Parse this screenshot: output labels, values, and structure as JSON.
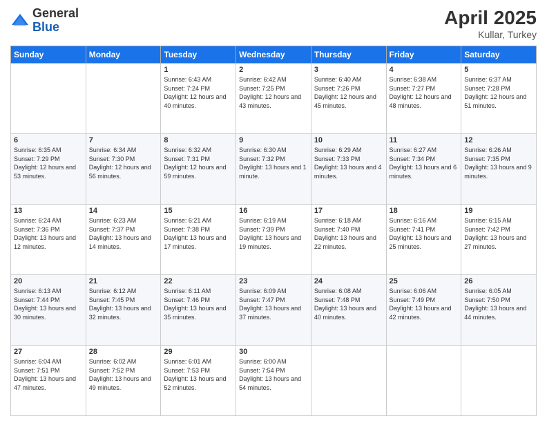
{
  "header": {
    "logo": {
      "general": "General",
      "blue": "Blue"
    },
    "title": "April 2025",
    "subtitle": "Kullar, Turkey"
  },
  "days_of_week": [
    "Sunday",
    "Monday",
    "Tuesday",
    "Wednesday",
    "Thursday",
    "Friday",
    "Saturday"
  ],
  "weeks": [
    [
      {
        "day": "",
        "sunrise": "",
        "sunset": "",
        "daylight": ""
      },
      {
        "day": "",
        "sunrise": "",
        "sunset": "",
        "daylight": ""
      },
      {
        "day": "1",
        "sunrise": "Sunrise: 6:43 AM",
        "sunset": "Sunset: 7:24 PM",
        "daylight": "Daylight: 12 hours and 40 minutes."
      },
      {
        "day": "2",
        "sunrise": "Sunrise: 6:42 AM",
        "sunset": "Sunset: 7:25 PM",
        "daylight": "Daylight: 12 hours and 43 minutes."
      },
      {
        "day": "3",
        "sunrise": "Sunrise: 6:40 AM",
        "sunset": "Sunset: 7:26 PM",
        "daylight": "Daylight: 12 hours and 45 minutes."
      },
      {
        "day": "4",
        "sunrise": "Sunrise: 6:38 AM",
        "sunset": "Sunset: 7:27 PM",
        "daylight": "Daylight: 12 hours and 48 minutes."
      },
      {
        "day": "5",
        "sunrise": "Sunrise: 6:37 AM",
        "sunset": "Sunset: 7:28 PM",
        "daylight": "Daylight: 12 hours and 51 minutes."
      }
    ],
    [
      {
        "day": "6",
        "sunrise": "Sunrise: 6:35 AM",
        "sunset": "Sunset: 7:29 PM",
        "daylight": "Daylight: 12 hours and 53 minutes."
      },
      {
        "day": "7",
        "sunrise": "Sunrise: 6:34 AM",
        "sunset": "Sunset: 7:30 PM",
        "daylight": "Daylight: 12 hours and 56 minutes."
      },
      {
        "day": "8",
        "sunrise": "Sunrise: 6:32 AM",
        "sunset": "Sunset: 7:31 PM",
        "daylight": "Daylight: 12 hours and 59 minutes."
      },
      {
        "day": "9",
        "sunrise": "Sunrise: 6:30 AM",
        "sunset": "Sunset: 7:32 PM",
        "daylight": "Daylight: 13 hours and 1 minute."
      },
      {
        "day": "10",
        "sunrise": "Sunrise: 6:29 AM",
        "sunset": "Sunset: 7:33 PM",
        "daylight": "Daylight: 13 hours and 4 minutes."
      },
      {
        "day": "11",
        "sunrise": "Sunrise: 6:27 AM",
        "sunset": "Sunset: 7:34 PM",
        "daylight": "Daylight: 13 hours and 6 minutes."
      },
      {
        "day": "12",
        "sunrise": "Sunrise: 6:26 AM",
        "sunset": "Sunset: 7:35 PM",
        "daylight": "Daylight: 13 hours and 9 minutes."
      }
    ],
    [
      {
        "day": "13",
        "sunrise": "Sunrise: 6:24 AM",
        "sunset": "Sunset: 7:36 PM",
        "daylight": "Daylight: 13 hours and 12 minutes."
      },
      {
        "day": "14",
        "sunrise": "Sunrise: 6:23 AM",
        "sunset": "Sunset: 7:37 PM",
        "daylight": "Daylight: 13 hours and 14 minutes."
      },
      {
        "day": "15",
        "sunrise": "Sunrise: 6:21 AM",
        "sunset": "Sunset: 7:38 PM",
        "daylight": "Daylight: 13 hours and 17 minutes."
      },
      {
        "day": "16",
        "sunrise": "Sunrise: 6:19 AM",
        "sunset": "Sunset: 7:39 PM",
        "daylight": "Daylight: 13 hours and 19 minutes."
      },
      {
        "day": "17",
        "sunrise": "Sunrise: 6:18 AM",
        "sunset": "Sunset: 7:40 PM",
        "daylight": "Daylight: 13 hours and 22 minutes."
      },
      {
        "day": "18",
        "sunrise": "Sunrise: 6:16 AM",
        "sunset": "Sunset: 7:41 PM",
        "daylight": "Daylight: 13 hours and 25 minutes."
      },
      {
        "day": "19",
        "sunrise": "Sunrise: 6:15 AM",
        "sunset": "Sunset: 7:42 PM",
        "daylight": "Daylight: 13 hours and 27 minutes."
      }
    ],
    [
      {
        "day": "20",
        "sunrise": "Sunrise: 6:13 AM",
        "sunset": "Sunset: 7:44 PM",
        "daylight": "Daylight: 13 hours and 30 minutes."
      },
      {
        "day": "21",
        "sunrise": "Sunrise: 6:12 AM",
        "sunset": "Sunset: 7:45 PM",
        "daylight": "Daylight: 13 hours and 32 minutes."
      },
      {
        "day": "22",
        "sunrise": "Sunrise: 6:11 AM",
        "sunset": "Sunset: 7:46 PM",
        "daylight": "Daylight: 13 hours and 35 minutes."
      },
      {
        "day": "23",
        "sunrise": "Sunrise: 6:09 AM",
        "sunset": "Sunset: 7:47 PM",
        "daylight": "Daylight: 13 hours and 37 minutes."
      },
      {
        "day": "24",
        "sunrise": "Sunrise: 6:08 AM",
        "sunset": "Sunset: 7:48 PM",
        "daylight": "Daylight: 13 hours and 40 minutes."
      },
      {
        "day": "25",
        "sunrise": "Sunrise: 6:06 AM",
        "sunset": "Sunset: 7:49 PM",
        "daylight": "Daylight: 13 hours and 42 minutes."
      },
      {
        "day": "26",
        "sunrise": "Sunrise: 6:05 AM",
        "sunset": "Sunset: 7:50 PM",
        "daylight": "Daylight: 13 hours and 44 minutes."
      }
    ],
    [
      {
        "day": "27",
        "sunrise": "Sunrise: 6:04 AM",
        "sunset": "Sunset: 7:51 PM",
        "daylight": "Daylight: 13 hours and 47 minutes."
      },
      {
        "day": "28",
        "sunrise": "Sunrise: 6:02 AM",
        "sunset": "Sunset: 7:52 PM",
        "daylight": "Daylight: 13 hours and 49 minutes."
      },
      {
        "day": "29",
        "sunrise": "Sunrise: 6:01 AM",
        "sunset": "Sunset: 7:53 PM",
        "daylight": "Daylight: 13 hours and 52 minutes."
      },
      {
        "day": "30",
        "sunrise": "Sunrise: 6:00 AM",
        "sunset": "Sunset: 7:54 PM",
        "daylight": "Daylight: 13 hours and 54 minutes."
      },
      {
        "day": "",
        "sunrise": "",
        "sunset": "",
        "daylight": ""
      },
      {
        "day": "",
        "sunrise": "",
        "sunset": "",
        "daylight": ""
      },
      {
        "day": "",
        "sunrise": "",
        "sunset": "",
        "daylight": ""
      }
    ]
  ]
}
